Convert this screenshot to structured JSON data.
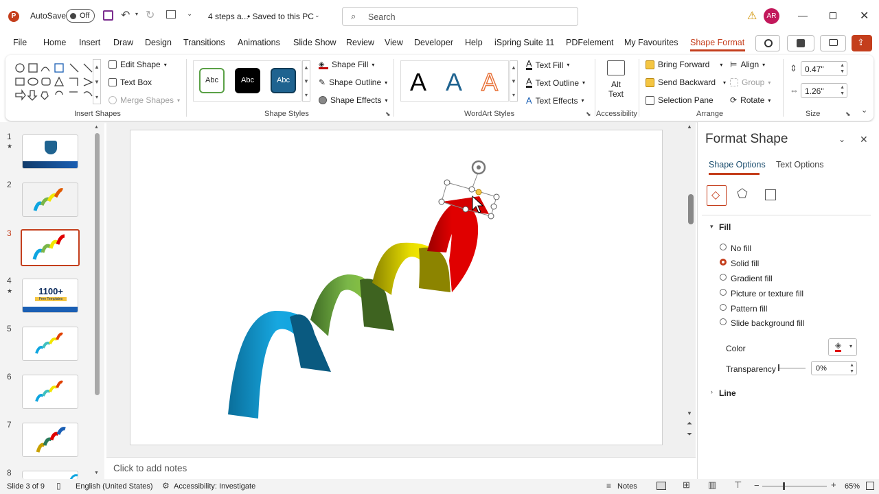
{
  "titlebar": {
    "autosave_label": "AutoSave",
    "autosave_state": "Off",
    "doc_title": "4 steps a...",
    "save_status": "• Saved to this PC",
    "search_placeholder": "Search",
    "avatar_initials": "AR"
  },
  "menu_tabs": [
    "File",
    "Home",
    "Insert",
    "Draw",
    "Design",
    "Transitions",
    "Animations",
    "Slide Show",
    "Review",
    "View",
    "Developer",
    "Help",
    "iSpring Suite 11",
    "PDFelement",
    "My Favourites",
    "Shape Format"
  ],
  "ribbon": {
    "insert_shapes": {
      "edit_shape": "Edit Shape",
      "text_box": "Text Box",
      "merge_shapes": "Merge Shapes",
      "label": "Insert Shapes"
    },
    "shape_styles": {
      "style_samples": [
        "Abc",
        "Abc",
        "Abc"
      ],
      "shape_fill": "Shape Fill",
      "shape_outline": "Shape Outline",
      "shape_effects": "Shape Effects",
      "label": "Shape Styles"
    },
    "wordart": {
      "samples": [
        "A",
        "A",
        "A"
      ],
      "text_fill": "Text Fill",
      "text_outline": "Text Outline",
      "text_effects": "Text Effects",
      "label": "WordArt Styles"
    },
    "accessibility": {
      "alt_text_line1": "Alt",
      "alt_text_line2": "Text",
      "label": "Accessibility"
    },
    "arrange": {
      "bring_forward": "Bring Forward",
      "send_backward": "Send Backward",
      "selection_pane": "Selection Pane",
      "align": "Align",
      "group": "Group",
      "rotate": "Rotate",
      "label": "Arrange"
    },
    "size": {
      "height": "0.47\"",
      "width": "1.26\"",
      "label": "Size"
    }
  },
  "thumbnails": [
    {
      "num": "1",
      "star": "★"
    },
    {
      "num": "2",
      "star": ""
    },
    {
      "num": "3",
      "star": ""
    },
    {
      "num": "4",
      "star": "★",
      "text": "1100+",
      "sub": "Free Templates"
    },
    {
      "num": "5",
      "star": ""
    },
    {
      "num": "6",
      "star": ""
    },
    {
      "num": "7",
      "star": ""
    },
    {
      "num": "8",
      "star": ""
    }
  ],
  "notes_placeholder": "Click to add notes",
  "format_pane": {
    "title": "Format Shape",
    "tab_shape": "Shape Options",
    "tab_text": "Text Options",
    "fill_header": "Fill",
    "fill_options": [
      "No fill",
      "Solid fill",
      "Gradient fill",
      "Picture or texture fill",
      "Pattern fill",
      "Slide background fill"
    ],
    "selected_fill": "Solid fill",
    "color_label": "Color",
    "transparency_label": "Transparency",
    "transparency_value": "0%",
    "line_header": "Line"
  },
  "status": {
    "slide_info": "Slide 3 of 9",
    "language": "English (United States)",
    "accessibility": "Accessibility: Investigate",
    "notes": "Notes",
    "zoom": "65%"
  },
  "colors": {
    "accent": "#c43e1c",
    "blue": "#0ea5e0",
    "green": "#7ab648",
    "yellow": "#f2e600",
    "red": "#e00000"
  }
}
